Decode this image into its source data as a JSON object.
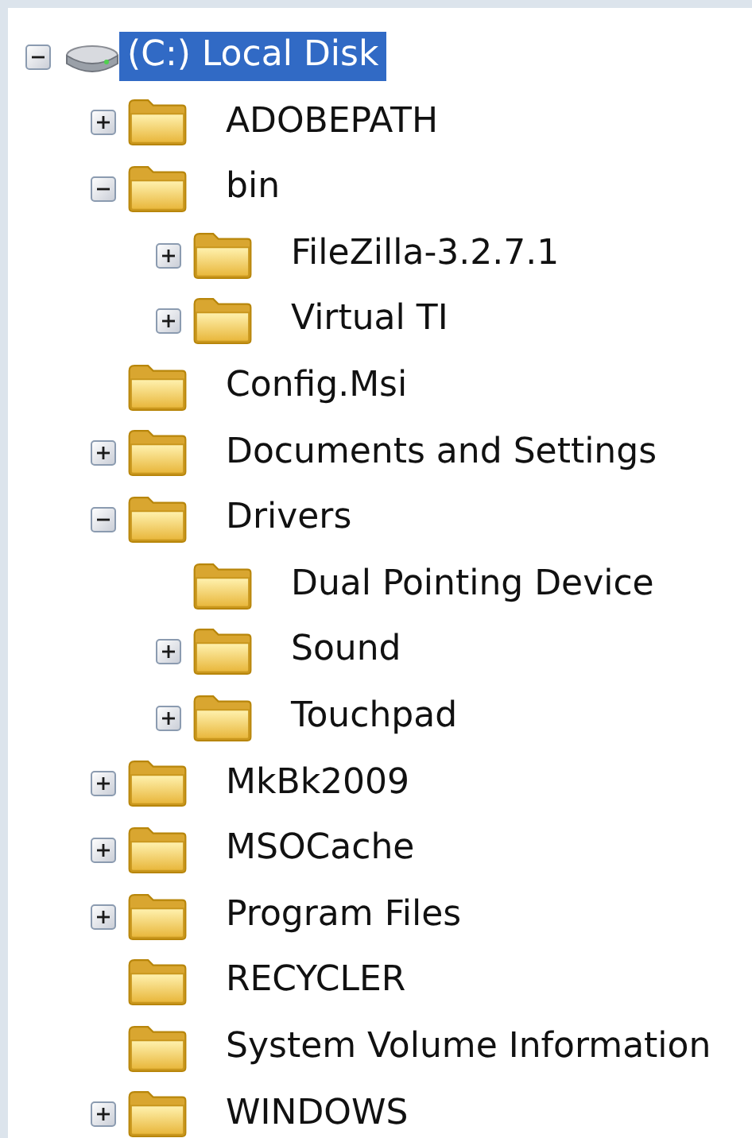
{
  "tree": [
    {
      "label": "(C:) Local Disk",
      "kind": "drive",
      "expanded": true,
      "selected": true,
      "children": [
        {
          "label": "ADOBEPATH",
          "kind": "folder",
          "expanded": false,
          "selected": false
        },
        {
          "label": "bin",
          "kind": "folder",
          "expanded": true,
          "selected": false,
          "children": [
            {
              "label": "FileZilla-3.2.7.1",
              "kind": "folder",
              "expanded": false,
              "selected": false
            },
            {
              "label": "Virtual TI",
              "kind": "folder",
              "expanded": false,
              "selected": false
            }
          ]
        },
        {
          "label": "Config.Msi",
          "kind": "folder",
          "selected": false
        },
        {
          "label": "Documents and Settings",
          "kind": "folder",
          "expanded": false,
          "selected": false
        },
        {
          "label": "Drivers",
          "kind": "folder",
          "expanded": true,
          "selected": false,
          "children": [
            {
              "label": "Dual Pointing Device",
              "kind": "folder",
              "selected": false
            },
            {
              "label": "Sound",
              "kind": "folder",
              "expanded": false,
              "selected": false
            },
            {
              "label": "Touchpad",
              "kind": "folder",
              "expanded": false,
              "selected": false
            }
          ]
        },
        {
          "label": "MkBk2009",
          "kind": "folder",
          "expanded": false,
          "selected": false
        },
        {
          "label": "MSOCache",
          "kind": "folder",
          "expanded": false,
          "selected": false
        },
        {
          "label": "Program Files",
          "kind": "folder",
          "expanded": false,
          "selected": false
        },
        {
          "label": "RECYCLER",
          "kind": "folder",
          "selected": false
        },
        {
          "label": "System Volume Information",
          "kind": "folder",
          "selected": false
        },
        {
          "label": "WINDOWS",
          "kind": "folder",
          "expanded": false,
          "selected": false
        }
      ]
    }
  ]
}
